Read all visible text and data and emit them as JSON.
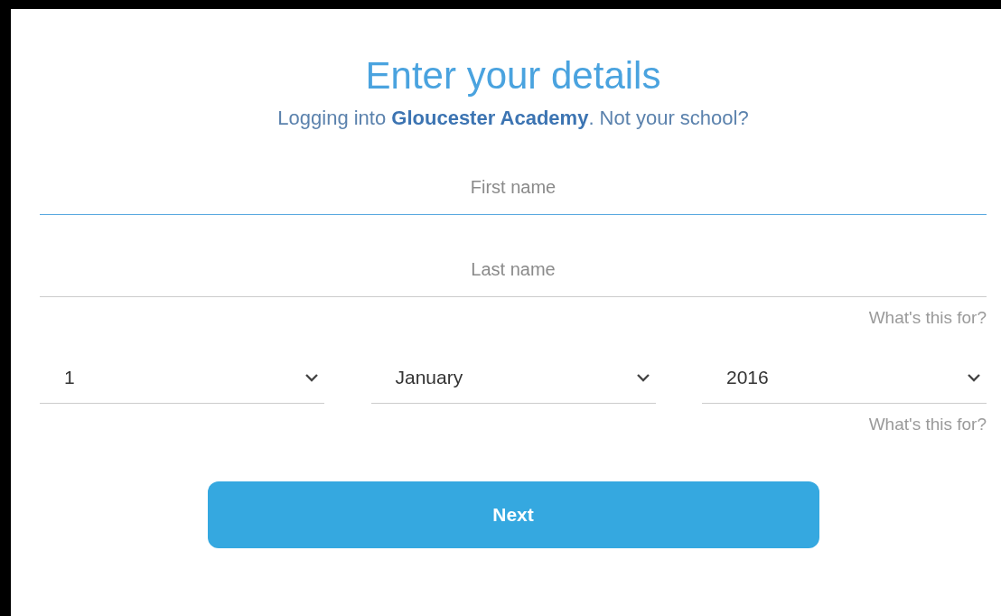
{
  "title": "Enter your details",
  "subtitle": "Logging into **Gloucester Academy**. Not your school?",
  "name_fields": [
    {
      "placeholder": "First name",
      "focused": true
    },
    {
      "placeholder": "Last name",
      "focused": false
    }
  ],
  "name_help": "What's this for?",
  "birth_date": [
    {
      "value": "1"
    },
    {
      "value": "January"
    },
    {
      "value": "2016"
    }
  ],
  "date_help": "What's this for?",
  "button": "Next"
}
